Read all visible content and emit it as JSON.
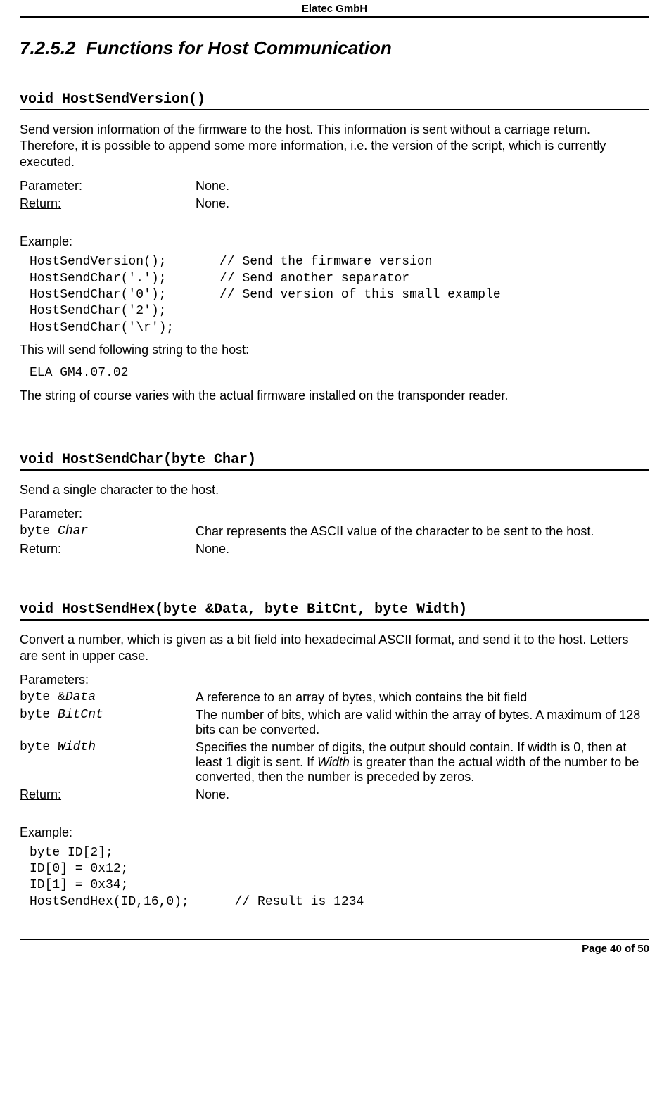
{
  "header": {
    "running": "Elatec GmbH"
  },
  "section": {
    "number": "7.2.5.2",
    "title": "Functions for Host Communication"
  },
  "hsv": {
    "signature": "void HostSendVersion()",
    "desc": "Send version information of the firmware to the host. This information is sent without a carriage return. Therefore, it is possible to append some more information, i.e. the version of the script, which is currently executed.",
    "param_label": "Parameter:",
    "param_value": "None.",
    "return_label": "Return:",
    "return_value": "None.",
    "example_label": "Example:",
    "code": "HostSendVersion();       // Send the firmware version\nHostSendChar('.');       // Send another separator\nHostSendChar('0');       // Send version of this small example\nHostSendChar('2');\nHostSendChar('\\r');",
    "result_intro": "This will send following string to the host:",
    "result_code": "ELA GM4.07.02",
    "result_note": "The string of course varies with the actual firmware installed on the transponder reader."
  },
  "hsc": {
    "signature": "void HostSendChar(byte Char)",
    "desc": "Send a single character to the host.",
    "param_label": "Parameter:",
    "p1_name": "byte ",
    "p1_var": "Char",
    "p1_desc": "Char represents the ASCII value of the character to be sent to the host.",
    "return_label": "Return:",
    "return_value": "None."
  },
  "hsh": {
    "signature": "void HostSendHex(byte &Data, byte BitCnt, byte Width)",
    "desc": "Convert a number, which is given as a bit field into hexadecimal ASCII format, and send it to the host. Letters are sent in upper case.",
    "params_label": "Parameters:",
    "p1_name": "byte &",
    "p1_var": "Data",
    "p1_desc": "A reference to an array of bytes, which contains the bit field",
    "p2_name": "byte ",
    "p2_var": "BitCnt",
    "p2_desc": "The number of bits, which are valid within the array of bytes. A maximum of 128 bits can be converted.",
    "p3_name": "byte ",
    "p3_var": "Width",
    "p3_desc_a": "Specifies the number of digits, the output should contain. If width is 0, then at least 1 digit is sent. If ",
    "p3_desc_w": "Width",
    "p3_desc_b": " is greater than the actual width of the number to be converted, then the number is preceded by zeros.",
    "return_label": "Return:",
    "return_value": "None.",
    "example_label": "Example:",
    "code": "byte ID[2];\nID[0] = 0x12;\nID[1] = 0x34;\nHostSendHex(ID,16,0);      // Result is 1234"
  },
  "footer": {
    "text": "Page 40 of 50"
  }
}
